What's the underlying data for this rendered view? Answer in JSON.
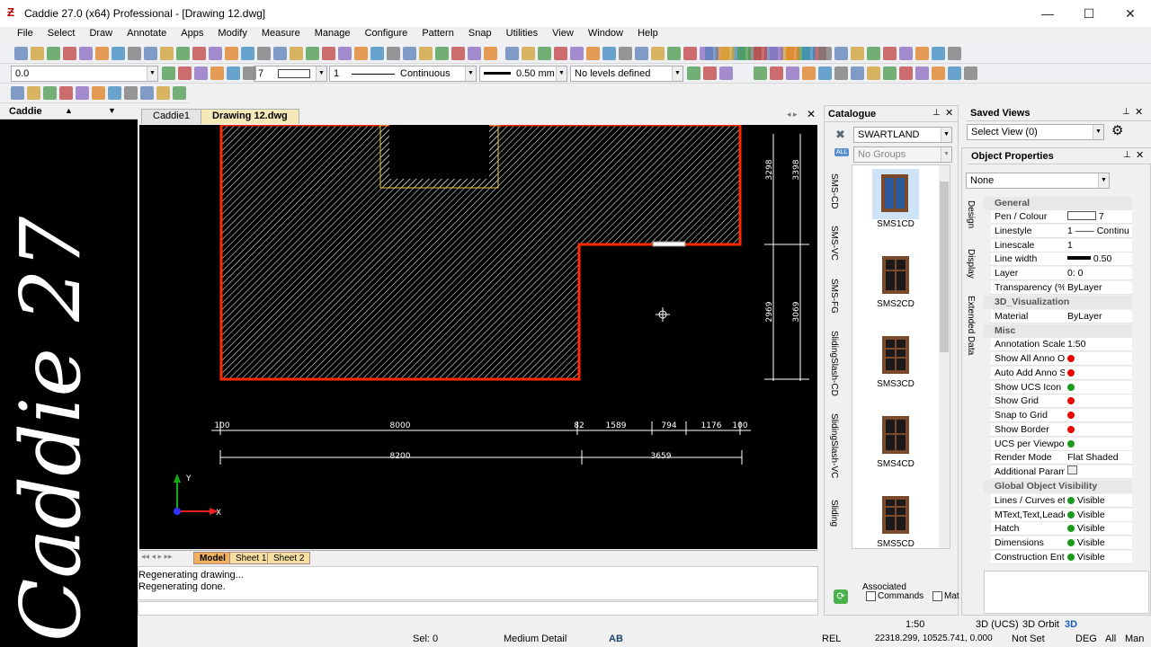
{
  "window": {
    "title": "Caddie 27.0 (x64) Professional - [Drawing 12.dwg]",
    "minimize": "—",
    "maximize": "☐",
    "close": "✕"
  },
  "menu": [
    "File",
    "Select",
    "Draw",
    "Annotate",
    "Apps",
    "Modify",
    "Measure",
    "Manage",
    "Configure",
    "Pattern",
    "Snap",
    "Utilities",
    "View",
    "Window",
    "Help"
  ],
  "props_bar": {
    "coord_value": "0.0",
    "pen_value": "7",
    "linestyle_value": "1",
    "linestyle_name": "Continuous",
    "linewidth": "0.50 mm",
    "levels": "No levels defined"
  },
  "sidebar": {
    "title": "Caddie",
    "logo_text": "Caddie 27"
  },
  "tabs": {
    "tab1": "Caddie1",
    "tab2": "Drawing 12.dwg"
  },
  "drawing": {
    "dims_bottom1": [
      "100",
      "8000",
      "82",
      "1589",
      "794",
      "1176",
      "100"
    ],
    "dims_bottom2": [
      "8200",
      "3659"
    ],
    "dims_right": [
      "3298",
      "3398",
      "2969",
      "3069"
    ],
    "ucs": {
      "y": "Y",
      "x": "X"
    }
  },
  "sheets": [
    "Model",
    "Sheet 1",
    "Sheet 2"
  ],
  "command": {
    "lines": [
      "Regenerating drawing...",
      "Regenerating done."
    ]
  },
  "status": {
    "sel": "Sel: 0",
    "detail": "Medium Detail",
    "ab": "AB",
    "scale": "1:50",
    "ucs": "3D (UCS)",
    "orbit": "3D Orbit",
    "td": "3D",
    "rel": "REL",
    "coords": "22318.299, 10525.741, 0.000",
    "notset": "Not Set",
    "deg": "DEG",
    "all": "All",
    "man": "Man"
  },
  "catalogue": {
    "title": "Catalogue",
    "library": "SWARTLAND",
    "groups": "No Groups",
    "all_label": "ALL",
    "vtabs": [
      "SMS-CD",
      "SMS-VC",
      "SMS-FG",
      "SlidingSlash-CD",
      "SlidingSlash-VC",
      "Sliding"
    ],
    "items": [
      "SMS1CD",
      "SMS2CD",
      "SMS3CD",
      "SMS4CD",
      "SMS5CD"
    ],
    "associated": "Associated",
    "commands": "Commands",
    "mat": "Mat"
  },
  "saved_views": {
    "title": "Saved Views",
    "select": "Select View (0)"
  },
  "object_properties": {
    "title": "Object Properties",
    "filter": "None",
    "side_tabs": [
      "Design",
      "Display",
      "Extended Data"
    ],
    "general": "General",
    "viz": "3D_Visualization",
    "misc": "Misc",
    "global": "Global Object Visibility",
    "rows": {
      "pen": {
        "name": "Pen / Colour",
        "value": "7"
      },
      "linestyle": {
        "name": "Linestyle",
        "value": "1",
        "value2": "Continu"
      },
      "linescale": {
        "name": "Linescale",
        "value": "1"
      },
      "linewidth": {
        "name": "Line width",
        "value": "0.50"
      },
      "layer": {
        "name": "Layer",
        "value": "0: 0"
      },
      "transparency": {
        "name": "Transparency (%)",
        "value": "ByLayer"
      },
      "material": {
        "name": "Material",
        "value": "ByLayer"
      },
      "annoscale": {
        "name": "Annotation Scale",
        "value": "1:50"
      },
      "showall": {
        "name": "Show All Anno O"
      },
      "autoadd": {
        "name": "Auto Add Anno S"
      },
      "showucs": {
        "name": "Show UCS Icon"
      },
      "showgrid": {
        "name": "Show Grid"
      },
      "snapgrid": {
        "name": "Snap to Grid"
      },
      "showborder": {
        "name": "Show Border"
      },
      "ucsvp": {
        "name": "UCS per Viewport"
      },
      "render": {
        "name": "Render Mode",
        "value": "Flat Shaded"
      },
      "addparam": {
        "name": "Additional Param"
      },
      "lines": {
        "name": "Lines / Curves etc",
        "value": "Visible"
      },
      "mtext": {
        "name": "MText,Text,Leade",
        "value": "Visible"
      },
      "hatch": {
        "name": "Hatch",
        "value": "Visible"
      },
      "dims": {
        "name": "Dimensions",
        "value": "Visible"
      },
      "constr": {
        "name": "Construction Enti",
        "value": "Visible"
      }
    }
  }
}
